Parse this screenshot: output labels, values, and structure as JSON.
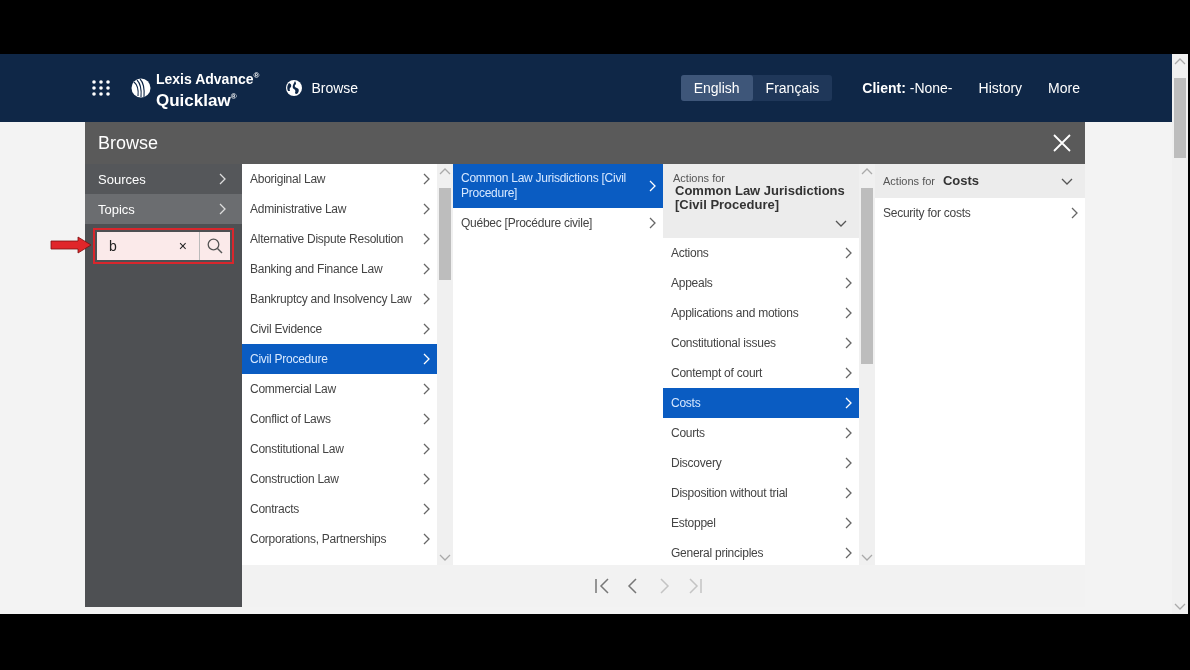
{
  "header": {
    "logo_line_1": "Lexis Advance$^{®}$",
    "logo_line_2": "Quicklaw$^{®}$",
    "browse_link": "Browse",
    "languages": [
      {
        "label": "English",
        "selected": true
      },
      {
        "label": "Français",
        "selected": false
      }
    ],
    "client_label": "Client:",
    "client_value": "-None-",
    "links": [
      "History",
      "More"
    ]
  },
  "modal": {
    "title": "Browse",
    "nav": [
      {
        "label": "Sources",
        "selected": false
      },
      {
        "label": "Topics",
        "selected": true
      }
    ],
    "search": {
      "value": "b",
      "clear": "×"
    },
    "columns": [
      {
        "kind": "list",
        "items": [
          {
            "label": "Aboriginal Law",
            "selected": false
          },
          {
            "label": "Administrative Law",
            "selected": false
          },
          {
            "label": "Alternative Dispute Resolution",
            "selected": false
          },
          {
            "label": "Banking and Finance Law",
            "selected": false
          },
          {
            "label": "Bankruptcy and Insolvency Law",
            "selected": false
          },
          {
            "label": "Civil Evidence",
            "selected": false
          },
          {
            "label": "Civil Procedure",
            "selected": true
          },
          {
            "label": "Commercial Law",
            "selected": false
          },
          {
            "label": "Conflict of Laws",
            "selected": false
          },
          {
            "label": "Constitutional Law",
            "selected": false
          },
          {
            "label": "Construction Law",
            "selected": false
          },
          {
            "label": "Contracts",
            "selected": false
          },
          {
            "label": "Corporations, Partnerships",
            "selected": false
          }
        ]
      },
      {
        "kind": "list",
        "items": [
          {
            "label": "Common Law Jurisdictions [Civil Procedure]",
            "selected": true
          },
          {
            "label": "Québec [Procédure civile]",
            "selected": false
          }
        ]
      },
      {
        "kind": "actions",
        "header_label": "Actions for",
        "header_title": "Common Law Jurisdictions [Civil Procedure]",
        "items": [
          {
            "label": "Actions",
            "selected": false
          },
          {
            "label": "Appeals",
            "selected": false
          },
          {
            "label": "Applications and motions",
            "selected": false
          },
          {
            "label": "Constitutional issues",
            "selected": false
          },
          {
            "label": "Contempt of court",
            "selected": false
          },
          {
            "label": "Costs",
            "selected": true
          },
          {
            "label": "Courts",
            "selected": false
          },
          {
            "label": "Discovery",
            "selected": false
          },
          {
            "label": "Disposition without trial",
            "selected": false
          },
          {
            "label": "Estoppel",
            "selected": false
          },
          {
            "label": "General principles",
            "selected": false
          }
        ]
      },
      {
        "kind": "actions-inline",
        "header_label": "Actions for",
        "header_title": "Costs",
        "items": [
          {
            "label": "Security for costs",
            "selected": false
          }
        ]
      }
    ],
    "pager": [
      {
        "kind": "first",
        "disabled": false
      },
      {
        "kind": "prev",
        "disabled": false
      },
      {
        "kind": "next",
        "disabled": true
      },
      {
        "kind": "last",
        "disabled": true
      }
    ]
  }
}
